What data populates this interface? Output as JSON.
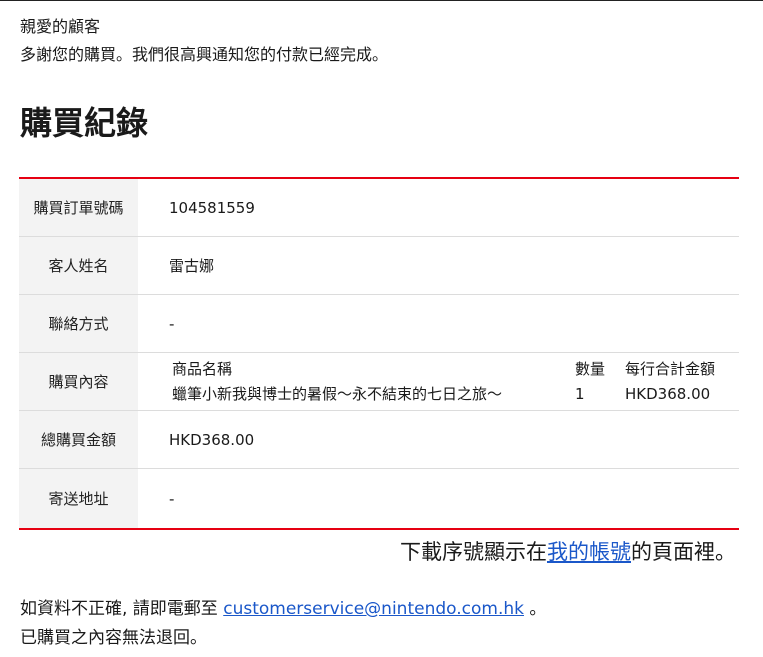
{
  "greeting": {
    "salutation": "親愛的顧客",
    "message": "多謝您的購買。我們很高興通知您的付款已經完成。"
  },
  "title": "購買紀錄",
  "record": {
    "order_number_label": "購買訂單號碼",
    "order_number": "104581559",
    "customer_name_label": "客人姓名",
    "customer_name": "雷古娜",
    "contact_label": "聯絡方式",
    "contact_value": "-",
    "content_label": "購買內容",
    "items_header": {
      "name": "商品名稱",
      "qty": "數量",
      "amount": "每行合計金額"
    },
    "items": [
      {
        "name": "蠟筆小新我與博士的暑假～永不結束的七日之旅～",
        "qty": "1",
        "amount": "HKD368.00"
      }
    ],
    "total_label": "總購買金額",
    "total": "HKD368.00",
    "address_label": "寄送地址",
    "address_value": "-"
  },
  "notice": {
    "before": "下載序號顯示在",
    "link": "我的帳號",
    "after": "的頁面裡。"
  },
  "contact": {
    "before": "如資料不正確, 請即電郵至 ",
    "email": "customerservice@nintendo.com.hk",
    "after": " 。",
    "no_refund": "已購買之內容無法退回。"
  },
  "colors": {
    "accent": "#e60012",
    "link": "#1a57c9",
    "label_bg": "#f3f3f3"
  }
}
